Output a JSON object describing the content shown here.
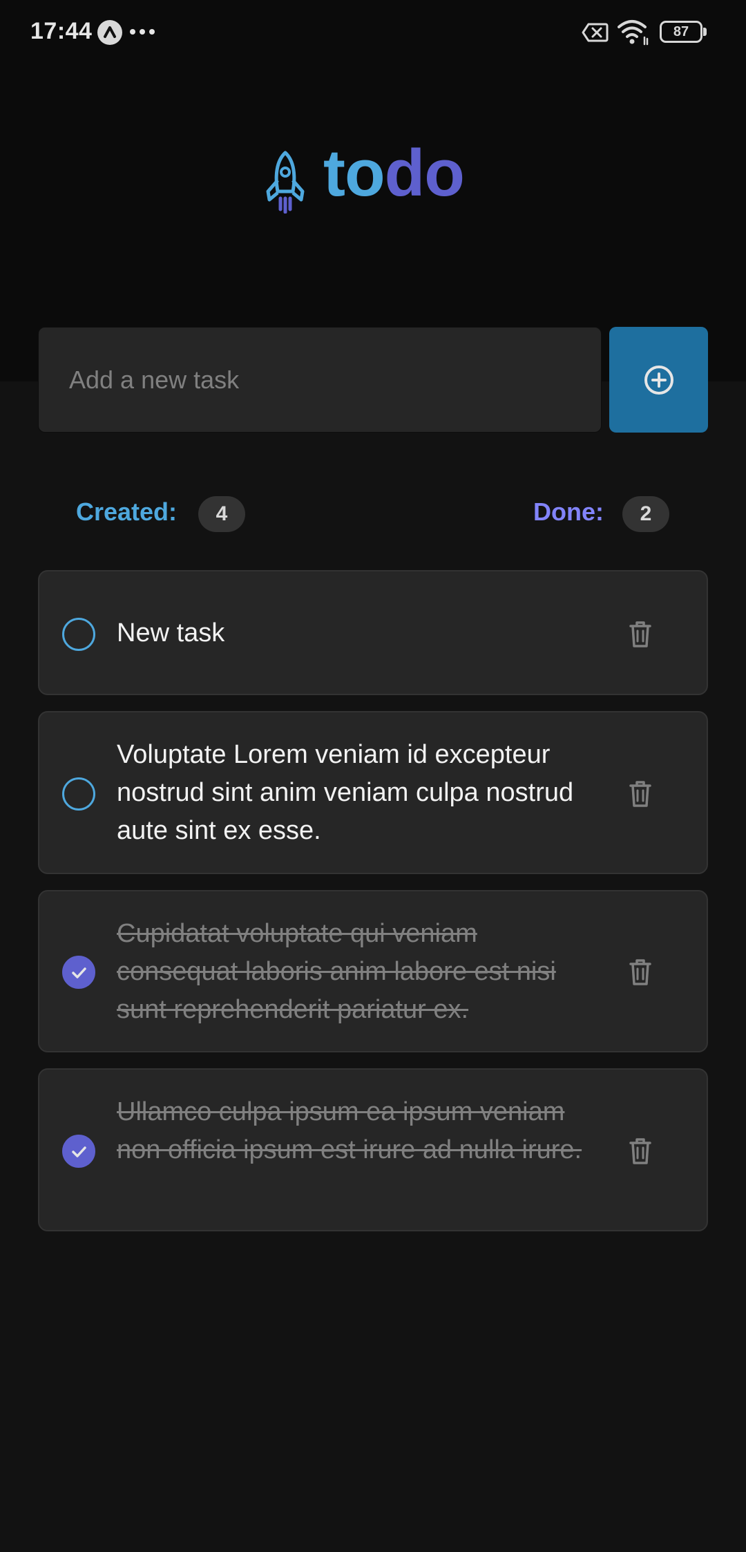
{
  "status_bar": {
    "time": "17:44",
    "battery": "87"
  },
  "header": {
    "logo_part1": "to",
    "logo_part2": "do",
    "icon": "rocket-icon",
    "colors": {
      "blue": "#4ea8de",
      "purple": "#5e60ce"
    }
  },
  "new_task": {
    "placeholder": "Add a new task",
    "value": "",
    "button_icon": "plus-circle-icon"
  },
  "counters": {
    "created_label": "Created:",
    "created_count": "4",
    "done_label": "Done:",
    "done_count": "2"
  },
  "tasks": [
    {
      "text": "New task",
      "done": false
    },
    {
      "text": "Voluptate Lorem veniam id excepteur nostrud sint anim veniam culpa nostrud aute sint ex esse.",
      "done": false
    },
    {
      "text": "Cupidatat voluptate qui veniam consequat laboris anim labore est nisi sunt reprehenderit pariatur ex.",
      "done": true
    },
    {
      "text": "Ullamco culpa ipsum ea ipsum veniam non officia ipsum est irure ad nulla irure.",
      "done": true
    }
  ]
}
